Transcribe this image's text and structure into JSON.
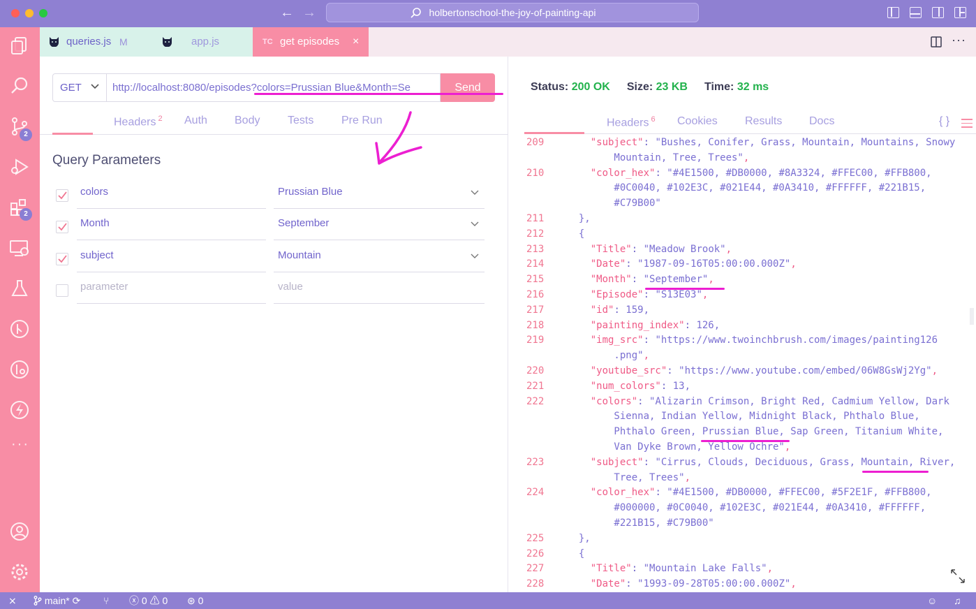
{
  "window": {
    "title": "holbertonschool-the-joy-of-painting-api"
  },
  "activity_bar": {
    "badges": [
      "2",
      "2"
    ]
  },
  "tabs": [
    {
      "label": "queries.js",
      "modifier": "M"
    },
    {
      "label": "app.js",
      "modifier": ""
    },
    {
      "label": "get episodes",
      "prefix": "TC",
      "close": "×"
    }
  ],
  "request": {
    "method": "GET",
    "url": "http://localhost:8080/episodes?colors=Prussian Blue&Month=Se",
    "send_label": "Send"
  },
  "request_tabs": [
    {
      "label": "Headers",
      "count": "2"
    },
    {
      "label": "Auth",
      "count": ""
    },
    {
      "label": "Body",
      "count": ""
    },
    {
      "label": "Tests",
      "count": ""
    },
    {
      "label": "Pre Run",
      "count": ""
    }
  ],
  "query_section_title": "Query Parameters",
  "query_params": [
    {
      "key": "colors",
      "value": "Prussian Blue",
      "checked": true
    },
    {
      "key": "Month",
      "value": "September",
      "checked": true
    },
    {
      "key": "subject",
      "value": "Mountain",
      "checked": true
    }
  ],
  "query_placeholder": {
    "key": "parameter",
    "value": "value"
  },
  "response": {
    "status_label": "Status:",
    "status_value": "200 OK",
    "size_label": "Size:",
    "size_value": "23 KB",
    "time_label": "Time:",
    "time_value": "32 ms"
  },
  "response_tabs": [
    {
      "label": "Headers",
      "count": "6"
    },
    {
      "label": "Cookies",
      "count": ""
    },
    {
      "label": "Results",
      "count": ""
    },
    {
      "label": "Docs",
      "count": ""
    }
  ],
  "braces_label": "{ }",
  "code_lines": [
    {
      "n": "209",
      "text": "    \"subject\": \"Bushes, Conifer, Grass, Mountain, Mountains, Snowy"
    },
    {
      "n": "",
      "text": "        Mountain, Tree, Trees\","
    },
    {
      "n": "210",
      "text": "    \"color_hex\": \"#4E1500, #DB0000, #8A3324, #FFEC00, #FFB800,"
    },
    {
      "n": "",
      "text": "        #0C0040, #102E3C, #021E44, #0A3410, #FFFFFF, #221B15,"
    },
    {
      "n": "",
      "text": "        #C79B00\""
    },
    {
      "n": "211",
      "text": "  },"
    },
    {
      "n": "212",
      "text": "  {"
    },
    {
      "n": "213",
      "text": "    \"Title\": \"Meadow Brook\","
    },
    {
      "n": "214",
      "text": "    \"Date\": \"1987-09-16T05:00:00.000Z\","
    },
    {
      "n": "215",
      "text": "    \"Month\": \"September\","
    },
    {
      "n": "216",
      "text": "    \"Episode\": \"S13E03\","
    },
    {
      "n": "217",
      "text": "    \"id\": 159,"
    },
    {
      "n": "218",
      "text": "    \"painting_index\": 126,"
    },
    {
      "n": "219",
      "text": "    \"img_src\": \"https://www.twoinchbrush.com/images/painting126"
    },
    {
      "n": "",
      "text": "        .png\","
    },
    {
      "n": "220",
      "text": "    \"youtube_src\": \"https://www.youtube.com/embed/06W8GsWj2Yg\","
    },
    {
      "n": "221",
      "text": "    \"num_colors\": 13,"
    },
    {
      "n": "222",
      "text": "    \"colors\": \"Alizarin Crimson, Bright Red, Cadmium Yellow, Dark"
    },
    {
      "n": "",
      "text": "        Sienna, Indian Yellow, Midnight Black, Phthalo Blue,"
    },
    {
      "n": "",
      "text": "        Phthalo Green, Prussian Blue, Sap Green, Titanium White,"
    },
    {
      "n": "",
      "text": "        Van Dyke Brown, Yellow Ochre\","
    },
    {
      "n": "223",
      "text": "    \"subject\": \"Cirrus, Clouds, Deciduous, Grass, Mountain, River,"
    },
    {
      "n": "",
      "text": "        Tree, Trees\","
    },
    {
      "n": "224",
      "text": "    \"color_hex\": \"#4E1500, #DB0000, #FFEC00, #5F2E1F, #FFB800,"
    },
    {
      "n": "",
      "text": "        #000000, #0C0040, #102E3C, #021E44, #0A3410, #FFFFFF,"
    },
    {
      "n": "",
      "text": "        #221B15, #C79B00\""
    },
    {
      "n": "225",
      "text": "  },"
    },
    {
      "n": "226",
      "text": "  {"
    },
    {
      "n": "227",
      "text": "    \"Title\": \"Mountain Lake Falls\","
    },
    {
      "n": "228",
      "text": "    \"Date\": \"1993-09-28T05:00:00.000Z\","
    }
  ],
  "status_bar": {
    "branch": "main*",
    "errors": "0",
    "warnings": "0",
    "ports": "0"
  },
  "colors": {
    "accent": "#f88da5",
    "title_bar": "#8f80d2",
    "ok_green": "#22b24c",
    "annotation": "#ec1fd1"
  }
}
